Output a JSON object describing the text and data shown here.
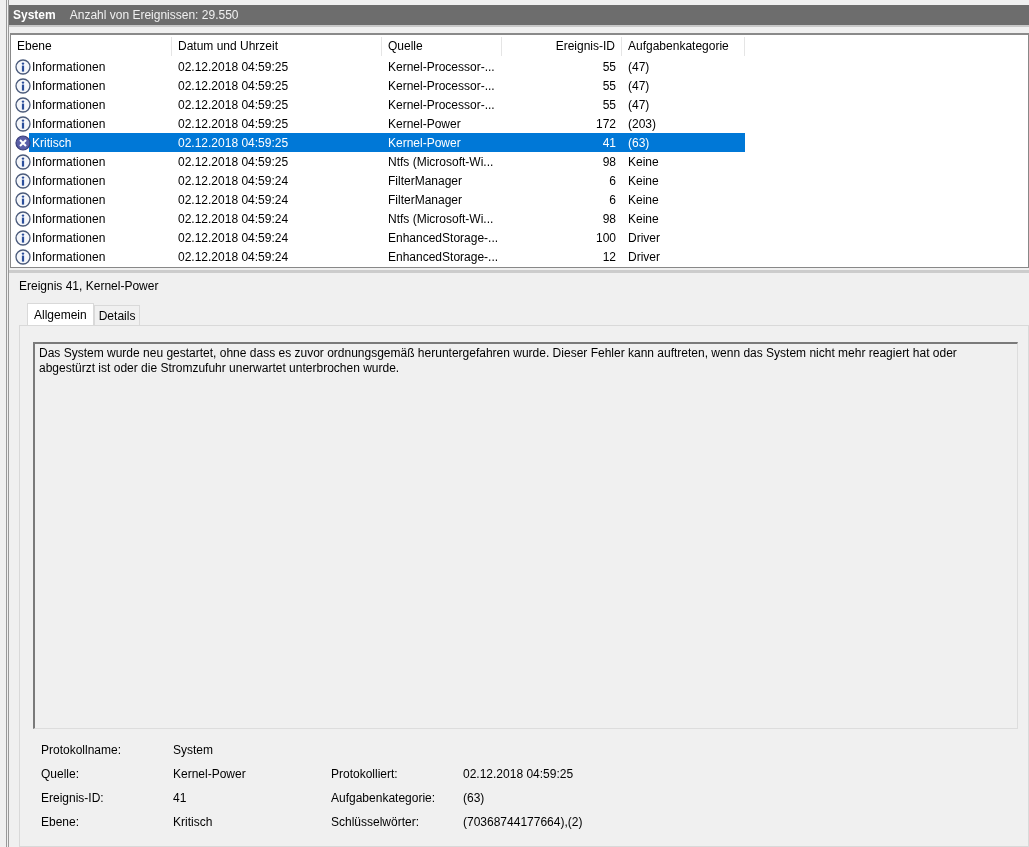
{
  "header": {
    "title": "System",
    "count": "Anzahl von Ereignissen: 29.550"
  },
  "table": {
    "columns": [
      "Ebene",
      "Datum und Uhrzeit",
      "Quelle",
      "Ereignis-ID",
      "Aufgabenkategorie"
    ],
    "rows": [
      {
        "kind": "info",
        "level": "Informationen",
        "date": "02.12.2018 04:59:25",
        "source": "Kernel-Processor-...",
        "id": "55",
        "category": "(47)",
        "selected": false
      },
      {
        "kind": "info",
        "level": "Informationen",
        "date": "02.12.2018 04:59:25",
        "source": "Kernel-Processor-...",
        "id": "55",
        "category": "(47)",
        "selected": false
      },
      {
        "kind": "info",
        "level": "Informationen",
        "date": "02.12.2018 04:59:25",
        "source": "Kernel-Processor-...",
        "id": "55",
        "category": "(47)",
        "selected": false
      },
      {
        "kind": "info",
        "level": "Informationen",
        "date": "02.12.2018 04:59:25",
        "source": "Kernel-Power",
        "id": "172",
        "category": "(203)",
        "selected": false
      },
      {
        "kind": "critical",
        "level": "Kritisch",
        "date": "02.12.2018 04:59:25",
        "source": "Kernel-Power",
        "id": "41",
        "category": "(63)",
        "selected": true
      },
      {
        "kind": "info",
        "level": "Informationen",
        "date": "02.12.2018 04:59:25",
        "source": "Ntfs (Microsoft-Wi...",
        "id": "98",
        "category": "Keine",
        "selected": false
      },
      {
        "kind": "info",
        "level": "Informationen",
        "date": "02.12.2018 04:59:24",
        "source": "FilterManager",
        "id": "6",
        "category": "Keine",
        "selected": false
      },
      {
        "kind": "info",
        "level": "Informationen",
        "date": "02.12.2018 04:59:24",
        "source": "FilterManager",
        "id": "6",
        "category": "Keine",
        "selected": false
      },
      {
        "kind": "info",
        "level": "Informationen",
        "date": "02.12.2018 04:59:24",
        "source": "Ntfs (Microsoft-Wi...",
        "id": "98",
        "category": "Keine",
        "selected": false
      },
      {
        "kind": "info",
        "level": "Informationen",
        "date": "02.12.2018 04:59:24",
        "source": "EnhancedStorage-...",
        "id": "100",
        "category": "Driver",
        "selected": false
      },
      {
        "kind": "info",
        "level": "Informationen",
        "date": "02.12.2018 04:59:24",
        "source": "EnhancedStorage-...",
        "id": "12",
        "category": "Driver",
        "selected": false
      }
    ]
  },
  "detail": {
    "title": "Ereignis 41, Kernel-Power",
    "tabs": [
      {
        "label": "Allgemein",
        "selected": true
      },
      {
        "label": "Details",
        "selected": false
      }
    ],
    "description": "Das System wurde neu gestartet, ohne dass es zuvor ordnungsgemäß heruntergefahren wurde. Dieser Fehler kann auftreten, wenn das System nicht mehr reagiert hat oder abgestürzt ist oder die Stromzufuhr unerwartet unterbrochen wurde.",
    "fields": [
      [
        {
          "label": "Protokollname:",
          "value": "System"
        }
      ],
      [
        {
          "label": "Quelle:",
          "value": "Kernel-Power"
        },
        {
          "label": "Protokolliert:",
          "value": "02.12.2018 04:59:25"
        }
      ],
      [
        {
          "label": "Ereignis-ID:",
          "value": "41"
        },
        {
          "label": "Aufgabenkategorie:",
          "value": "(63)"
        }
      ],
      [
        {
          "label": "Ebene:",
          "value": "Kritisch"
        },
        {
          "label": "Schlüsselwörter:",
          "value": "(70368744177664),(2)"
        }
      ]
    ]
  }
}
